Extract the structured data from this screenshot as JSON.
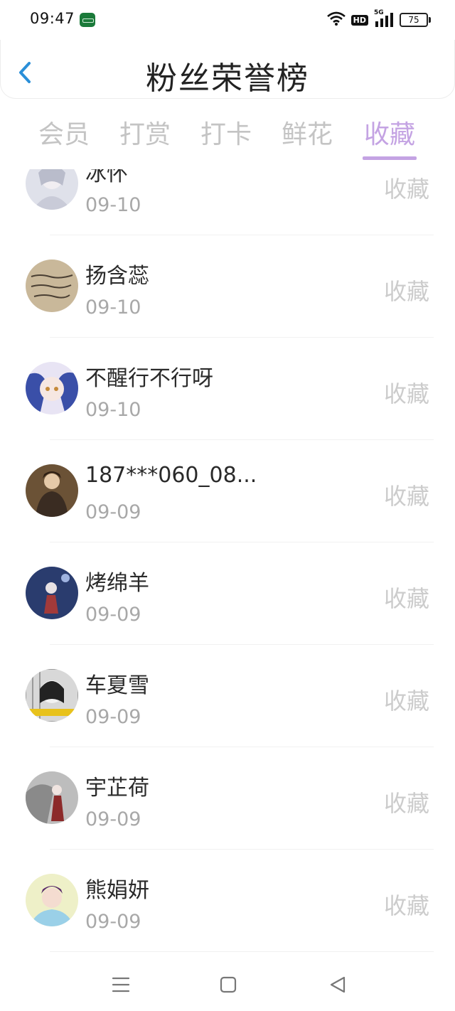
{
  "status_bar": {
    "time": "09:47",
    "network": "5G",
    "hd": "HD",
    "battery": "75"
  },
  "header": {
    "title": "粉丝荣誉榜"
  },
  "tabs": [
    {
      "label": "会员",
      "active": false
    },
    {
      "label": "打赏",
      "active": false
    },
    {
      "label": "打卡",
      "active": false
    },
    {
      "label": "鲜花",
      "active": false
    },
    {
      "label": "收藏",
      "active": true
    }
  ],
  "colors": {
    "accent": "#c4a3e3",
    "back_arrow": "#2a8fd8",
    "muted_text": "#a8a8a8",
    "action_text": "#cccccc"
  },
  "fans": [
    {
      "name": "冰怀",
      "date": "09-10",
      "action": "收藏"
    },
    {
      "name": "扬含蕊",
      "date": "09-10",
      "action": "收藏"
    },
    {
      "name": "不醒行不行呀",
      "date": "09-10",
      "action": "收藏"
    },
    {
      "name": "187***060_08...",
      "date": "09-09",
      "action": "收藏"
    },
    {
      "name": "烤绵羊",
      "date": "09-09",
      "action": "收藏"
    },
    {
      "name": "车夏雪",
      "date": "09-09",
      "action": "收藏"
    },
    {
      "name": "宇芷荷",
      "date": "09-09",
      "action": "收藏"
    },
    {
      "name": "熊娟妍",
      "date": "09-09",
      "action": "收藏"
    }
  ],
  "nav": {
    "icons": [
      "menu-icon",
      "home-square-icon",
      "back-triangle-icon"
    ]
  }
}
